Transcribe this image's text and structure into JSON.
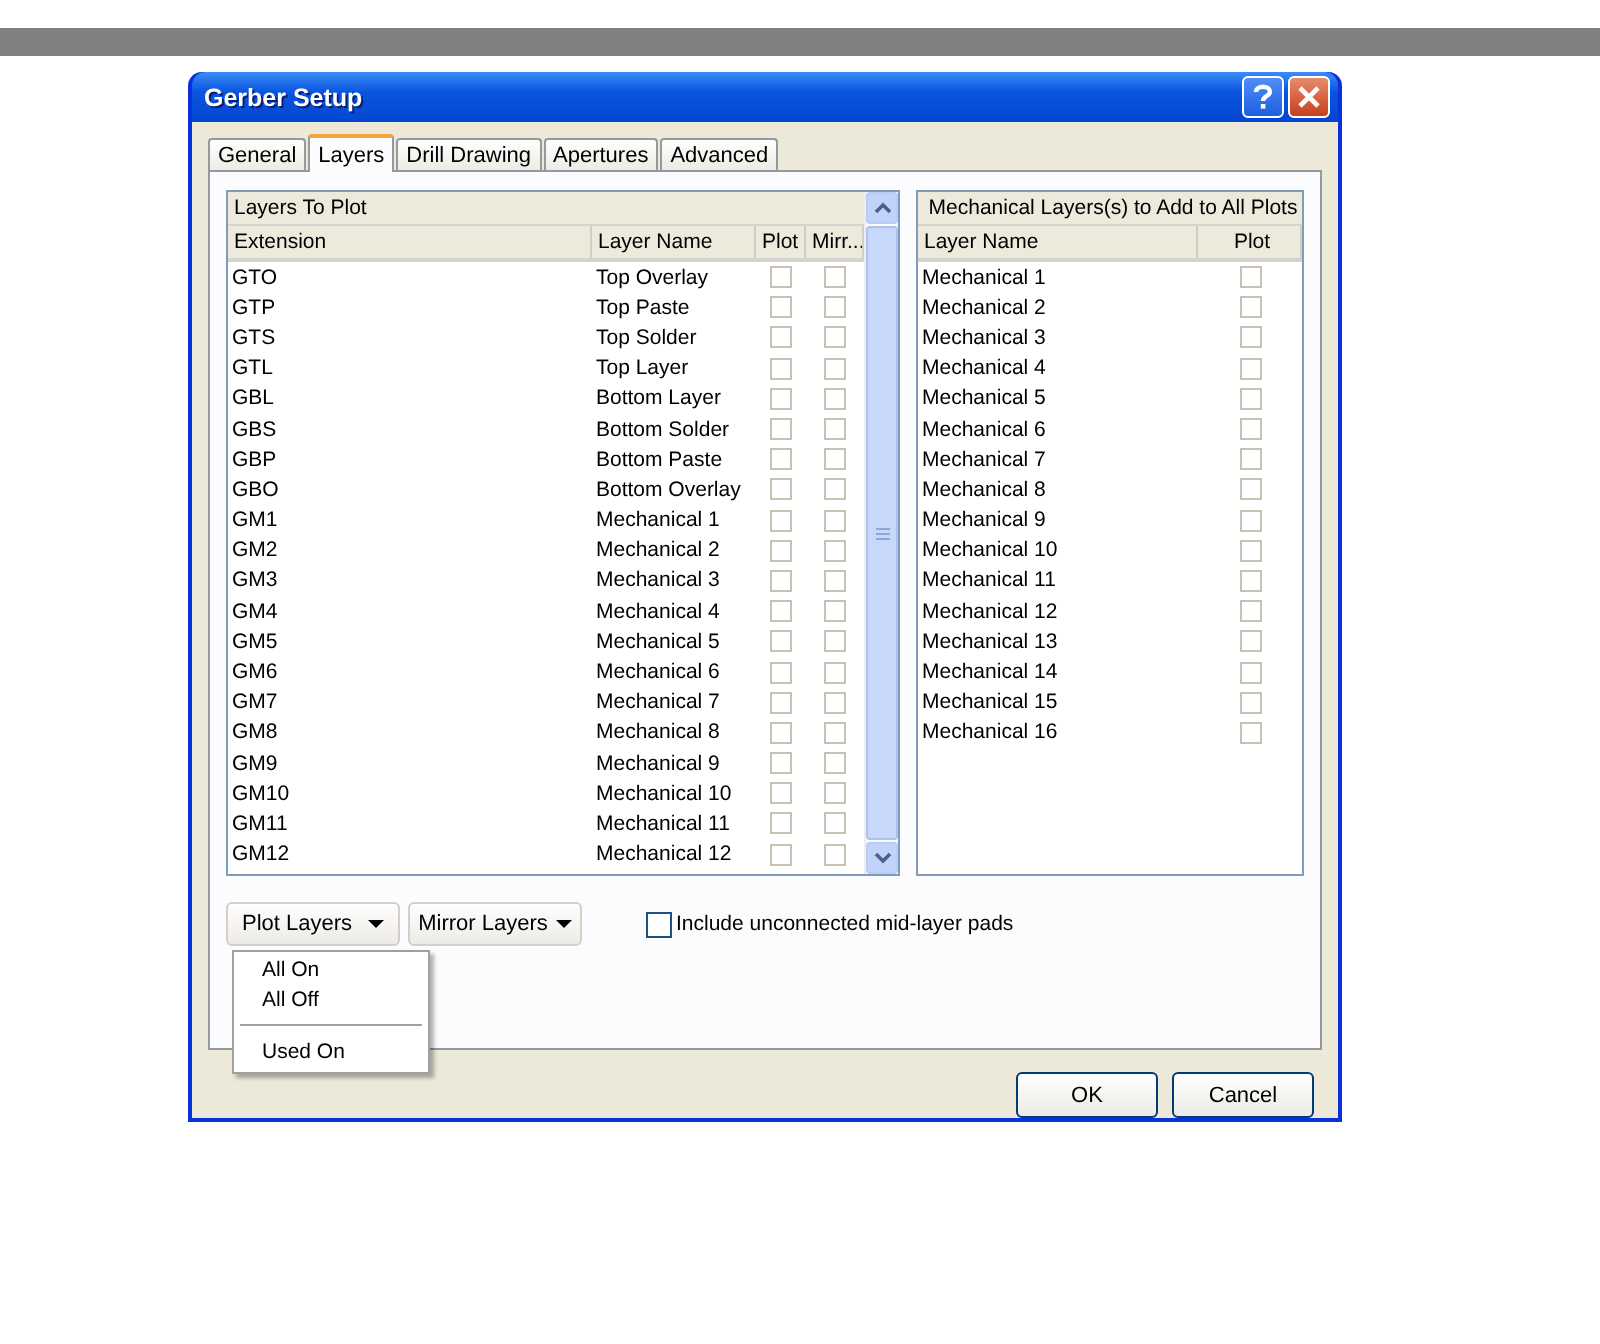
{
  "window": {
    "title": "Gerber Setup"
  },
  "tabs": [
    {
      "label": "General",
      "selected": false
    },
    {
      "label": "Layers",
      "selected": true
    },
    {
      "label": "Drill Drawing",
      "selected": false
    },
    {
      "label": "Apertures",
      "selected": false
    },
    {
      "label": "Advanced",
      "selected": false
    }
  ],
  "layers_table": {
    "title": "Layers To Plot",
    "columns": [
      "Extension",
      "Layer Name",
      "Plot",
      "Mirr..."
    ],
    "rows": [
      {
        "extension": "GTO",
        "layer_name": "Top Overlay",
        "plot": false,
        "mirror": false
      },
      {
        "extension": "GTP",
        "layer_name": "Top Paste",
        "plot": false,
        "mirror": false
      },
      {
        "extension": "GTS",
        "layer_name": "Top Solder",
        "plot": false,
        "mirror": false
      },
      {
        "extension": "GTL",
        "layer_name": "Top Layer",
        "plot": false,
        "mirror": false
      },
      {
        "extension": "GBL",
        "layer_name": "Bottom Layer",
        "plot": false,
        "mirror": false
      },
      {
        "extension": "GBS",
        "layer_name": "Bottom Solder",
        "plot": false,
        "mirror": false
      },
      {
        "extension": "GBP",
        "layer_name": "Bottom Paste",
        "plot": false,
        "mirror": false
      },
      {
        "extension": "GBO",
        "layer_name": "Bottom Overlay",
        "plot": false,
        "mirror": false
      },
      {
        "extension": "GM1",
        "layer_name": "Mechanical 1",
        "plot": false,
        "mirror": false
      },
      {
        "extension": "GM2",
        "layer_name": "Mechanical 2",
        "plot": false,
        "mirror": false
      },
      {
        "extension": "GM3",
        "layer_name": "Mechanical 3",
        "plot": false,
        "mirror": false
      },
      {
        "extension": "GM4",
        "layer_name": "Mechanical 4",
        "plot": false,
        "mirror": false
      },
      {
        "extension": "GM5",
        "layer_name": "Mechanical 5",
        "plot": false,
        "mirror": false
      },
      {
        "extension": "GM6",
        "layer_name": "Mechanical 6",
        "plot": false,
        "mirror": false
      },
      {
        "extension": "GM7",
        "layer_name": "Mechanical 7",
        "plot": false,
        "mirror": false
      },
      {
        "extension": "GM8",
        "layer_name": "Mechanical 8",
        "plot": false,
        "mirror": false
      },
      {
        "extension": "GM9",
        "layer_name": "Mechanical 9",
        "plot": false,
        "mirror": false
      },
      {
        "extension": "GM10",
        "layer_name": "Mechanical 10",
        "plot": false,
        "mirror": false
      },
      {
        "extension": "GM11",
        "layer_name": "Mechanical 11",
        "plot": false,
        "mirror": false
      },
      {
        "extension": "GM12",
        "layer_name": "Mechanical 12",
        "plot": false,
        "mirror": false
      }
    ]
  },
  "mechanical_table": {
    "title": "Mechanical Layers(s) to Add to All Plots",
    "columns": [
      "Layer Name",
      "Plot"
    ],
    "rows": [
      {
        "layer_name": "Mechanical 1",
        "plot": false
      },
      {
        "layer_name": "Mechanical 2",
        "plot": false
      },
      {
        "layer_name": "Mechanical 3",
        "plot": false
      },
      {
        "layer_name": "Mechanical 4",
        "plot": false
      },
      {
        "layer_name": "Mechanical 5",
        "plot": false
      },
      {
        "layer_name": "Mechanical 6",
        "plot": false
      },
      {
        "layer_name": "Mechanical 7",
        "plot": false
      },
      {
        "layer_name": "Mechanical 8",
        "plot": false
      },
      {
        "layer_name": "Mechanical 9",
        "plot": false
      },
      {
        "layer_name": "Mechanical 10",
        "plot": false
      },
      {
        "layer_name": "Mechanical 11",
        "plot": false
      },
      {
        "layer_name": "Mechanical 12",
        "plot": false
      },
      {
        "layer_name": "Mechanical 13",
        "plot": false
      },
      {
        "layer_name": "Mechanical 14",
        "plot": false
      },
      {
        "layer_name": "Mechanical 15",
        "plot": false
      },
      {
        "layer_name": "Mechanical 16",
        "plot": false
      }
    ]
  },
  "plot_layers_button": "Plot Layers",
  "mirror_layers_button": "Mirror Layers",
  "include_unconnected": {
    "label": "Include unconnected mid-layer pads",
    "checked": false
  },
  "plot_layers_menu": [
    {
      "kind": "item",
      "label": "All On"
    },
    {
      "kind": "item",
      "label": "All Off"
    },
    {
      "kind": "separator"
    },
    {
      "kind": "item",
      "label": "Used On"
    }
  ],
  "buttons": [
    "OK",
    "Cancel"
  ]
}
